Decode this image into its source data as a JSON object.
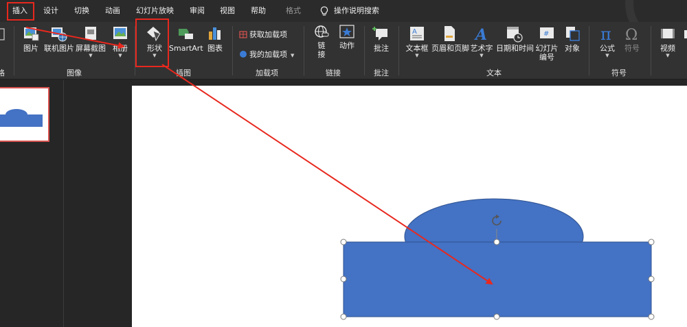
{
  "tabs": [
    {
      "label": "插入",
      "active": true
    },
    {
      "label": "设计"
    },
    {
      "label": "切换"
    },
    {
      "label": "动画"
    },
    {
      "label": "幻灯片放映"
    },
    {
      "label": "审阅"
    },
    {
      "label": "视图"
    },
    {
      "label": "帮助"
    },
    {
      "label": "格式",
      "dim": true
    }
  ],
  "tell_me": "操作说明搜索",
  "ribbon": {
    "left_cut_label": "格",
    "images": {
      "picture": "图片",
      "online_picture": "联机图片",
      "screenshot": "屏幕截图",
      "album": "相册",
      "group": "图像"
    },
    "illustrations": {
      "shapes": "形状",
      "smartart": "SmartArt",
      "chart": "图表",
      "group": "插图"
    },
    "addins": {
      "get": "获取加载项",
      "my": "我的加载项",
      "group": "加载项"
    },
    "links": {
      "link_line1": "链",
      "link_line2": "接",
      "action": "动作",
      "group": "链接"
    },
    "comments": {
      "comment": "批注",
      "group": "批注"
    },
    "text": {
      "textbox": "文本框",
      "header_footer": "页眉和页脚",
      "wordart": "艺术字",
      "datetime": "日期和时间",
      "slide_number_line1": "幻灯片",
      "slide_number_line2": "编号",
      "object": "对象",
      "group": "文本"
    },
    "symbols": {
      "equation": "公式",
      "symbol": "符号",
      "group": "符号"
    },
    "media": {
      "video": "视频"
    }
  },
  "colors": {
    "shape_fill": "#4472c4",
    "annotation_red": "#e8281e",
    "thumb_border": "#d9534f"
  }
}
